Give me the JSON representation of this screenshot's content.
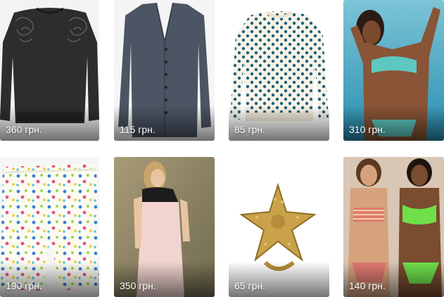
{
  "products": [
    {
      "price": "360 грн.",
      "image": "black-embellished-sweatshirt"
    },
    {
      "price": "115 грн.",
      "image": "grey-button-cardigan"
    },
    {
      "price": "85 грн.",
      "image": "polka-dot-sweater"
    },
    {
      "price": "310 грн.",
      "image": "turquoise-bikini-model"
    },
    {
      "price": "190 грн.",
      "image": "floral-print-shorts"
    },
    {
      "price": "350 грн.",
      "image": "pink-lace-dress-model"
    },
    {
      "price": "65 грн.",
      "image": "gold-starfish-ring"
    },
    {
      "price": "140 грн.",
      "image": "striped-and-green-bikini-models"
    }
  ]
}
